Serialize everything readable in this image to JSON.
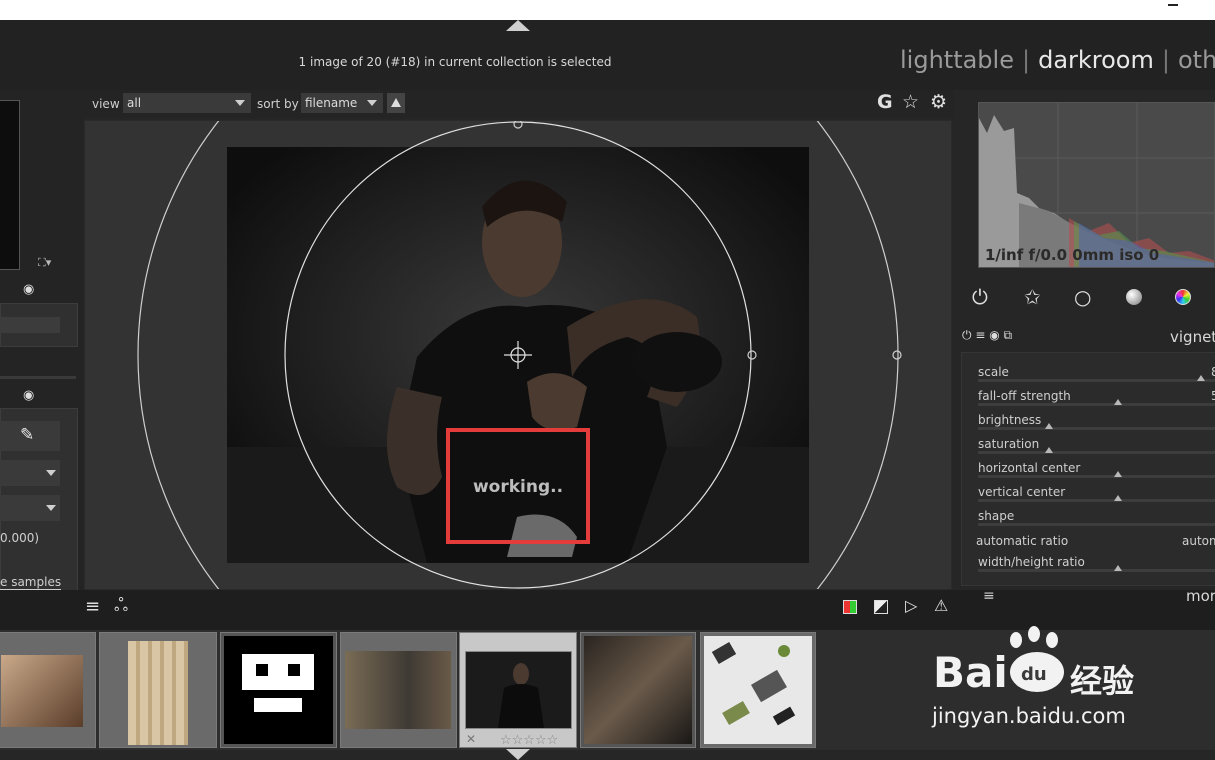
{
  "header": {
    "collection_info": "1 image of 20 (#18) in current collection is selected",
    "views": [
      "lighttable",
      "darkroom",
      "oth"
    ],
    "active_view": "darkroom"
  },
  "toolbar": {
    "view_label": "view",
    "view_value": "all",
    "sort_label": "sort by",
    "sort_value": "filename",
    "icons": [
      "grouping-icon",
      "star-icon",
      "gear-icon"
    ],
    "grouping_glyph": "G"
  },
  "left_panel": {
    "color_value": "0.000)",
    "samples_link": "e samples"
  },
  "center": {
    "status": "working.."
  },
  "right_panel": {
    "exif": "1/inf f/0.0 0mm iso 0",
    "module_title": "vignett",
    "params": [
      {
        "label": "scale",
        "value": "8"
      },
      {
        "label": "fall-off strength",
        "value": "5"
      },
      {
        "label": "brightness",
        "value": ""
      },
      {
        "label": "saturation",
        "value": ""
      },
      {
        "label": "horizontal center",
        "value": ""
      },
      {
        "label": "vertical center",
        "value": ""
      },
      {
        "label": "shape",
        "value": ""
      },
      {
        "label": "automatic ratio",
        "value": "autom"
      },
      {
        "label": "width/height ratio",
        "value": ""
      }
    ],
    "more_label": "mor"
  },
  "watermark": {
    "brand_a": "Bai",
    "brand_b": "du",
    "brand_c": "经验",
    "url": "jingyan.baidu.com"
  },
  "colors": {
    "accent_red": "#e43b3b",
    "panel_bg": "#262626"
  }
}
